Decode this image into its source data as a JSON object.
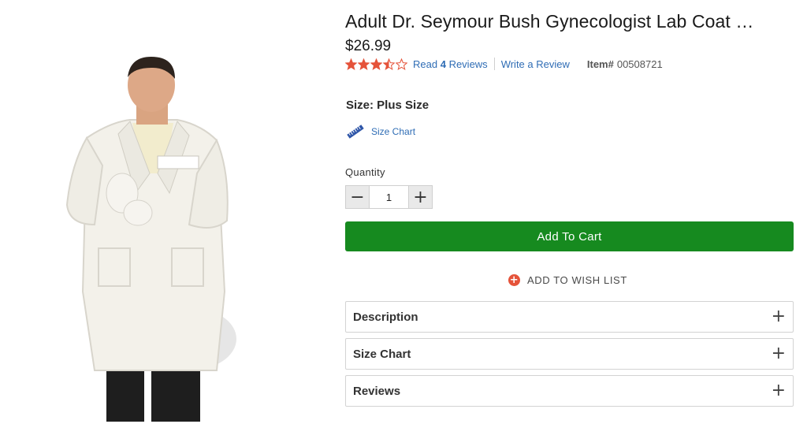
{
  "product": {
    "title": "Adult Dr. Seymour Bush Gynecologist Lab Coat …",
    "price": "$26.99",
    "rating_stars": 3.5,
    "rating_max": 5,
    "read_prefix": "Read",
    "review_count": "4",
    "read_suffix": "Reviews",
    "write_review": "Write a Review",
    "item_label": "Item#",
    "item_number": "00508721"
  },
  "size": {
    "label": "Size: Plus Size",
    "chart_link": "Size Chart"
  },
  "quantity": {
    "label": "Quantity",
    "value": "1",
    "decrement": "−",
    "increment": "+"
  },
  "actions": {
    "add_to_cart": "Add To Cart",
    "wishlist": "ADD TO WISH LIST",
    "wishlist_icon": "+"
  },
  "accordions": [
    {
      "label": "Description",
      "icon": "+"
    },
    {
      "label": "Size Chart",
      "icon": "+"
    },
    {
      "label": "Reviews",
      "icon": "+"
    }
  ],
  "colors": {
    "accent_green": "#168a1f",
    "link_blue": "#2f6db5",
    "star_orange": "#e5533a",
    "wishlist_red": "#e5533a"
  },
  "icons": {
    "star": "star-icon",
    "ruler": "ruler-icon",
    "plus": "plus-icon"
  }
}
